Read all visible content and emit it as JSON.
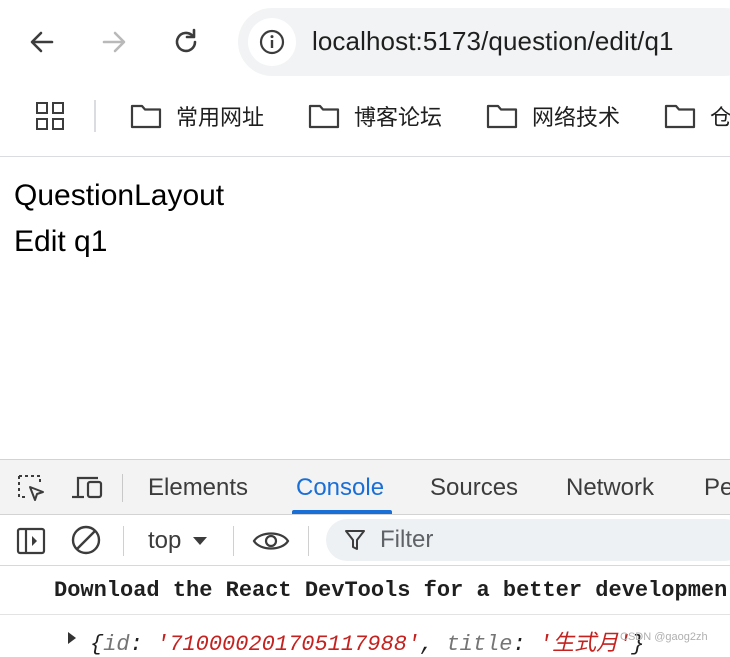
{
  "browser": {
    "url": "localhost:5173/question/edit/q1",
    "bookmarks": [
      {
        "label": "常用网址",
        "icon": "folder-icon"
      },
      {
        "label": "博客论坛",
        "icon": "folder-icon"
      },
      {
        "label": "网络技术",
        "icon": "folder-icon"
      },
      {
        "label": "仓",
        "icon": "folder-icon"
      }
    ]
  },
  "page": {
    "line1": "QuestionLayout",
    "line2": "Edit q1"
  },
  "devtools": {
    "tabs": [
      "Elements",
      "Console",
      "Sources",
      "Network",
      "Pe"
    ],
    "active_tab": "Console",
    "toolbar": {
      "context": "top",
      "filter_placeholder": "Filter"
    },
    "messages": {
      "info": "Download the React DevTools for a better developmen",
      "object": {
        "open_brace": "{",
        "key_id": "id",
        "colon": ": ",
        "val_id": "'710000201705117988'",
        "sep": ", ",
        "key_title": "title",
        "val_title": "'生式月'",
        "close_brace": "}"
      }
    }
  },
  "watermark": "CSDN @gaog2zh",
  "colors": {
    "accent": "#1a6fd6",
    "string": "#c5221f"
  }
}
